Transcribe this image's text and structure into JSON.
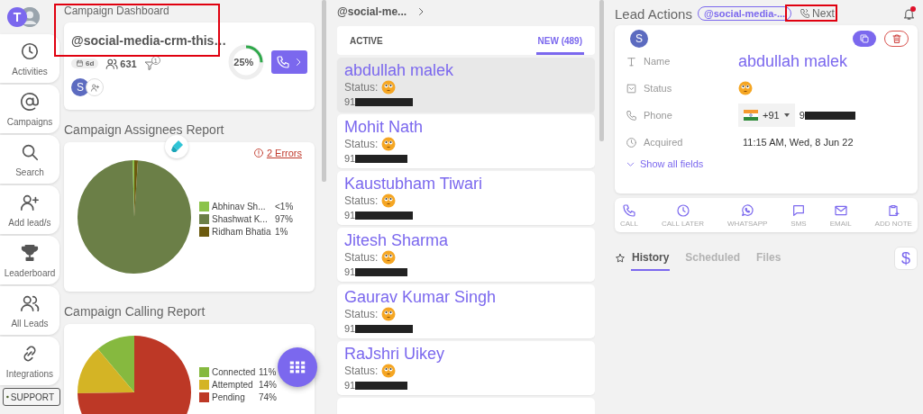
{
  "nav": {
    "avatar_letter": "T",
    "items": [
      {
        "label": "Activities",
        "selected": false
      },
      {
        "label": "Campaigns",
        "selected": false
      },
      {
        "label": "Search",
        "selected": false
      },
      {
        "label": "Add lead/s",
        "selected": false
      },
      {
        "label": "Leaderboard",
        "selected": false
      },
      {
        "label": "All Leads",
        "selected": false
      },
      {
        "label": "Integrations",
        "selected": false
      }
    ],
    "support": "SUPPORT"
  },
  "dashboard": {
    "title": "Campaign Dashboard",
    "campaign_name": "@social-media-crm-this…",
    "duration": "6d",
    "leads_count": "631",
    "filter_count": "1",
    "assignee_initial": "S",
    "progress": {
      "level": 0.25,
      "reading": "25%"
    }
  },
  "assignees_report": {
    "title": "Campaign Assignees Report",
    "errors_link": "2 Errors",
    "chart_data": {
      "type": "pie",
      "categories": [
        "Abhinav Sh...",
        "Shashwat K...",
        "Ridham Bhatia"
      ],
      "values": [
        0.5,
        97,
        1
      ],
      "value_labels": [
        "<1%",
        "97%",
        "1%"
      ]
    },
    "legend": [
      {
        "color": "#8bc34a"
      },
      {
        "color": "#6b7f47"
      },
      {
        "color": "#6b5a0e"
      }
    ]
  },
  "calling_report": {
    "title": "Campaign Calling Report",
    "chart_data": {
      "type": "pie",
      "categories": [
        "Connected",
        "Attempted",
        "Pending"
      ],
      "values": [
        11,
        14,
        74
      ],
      "value_labels": [
        "11%",
        "14%",
        "74%"
      ]
    },
    "legend": [
      {
        "color": "#86b93f"
      },
      {
        "color": "#d4b425"
      },
      {
        "color": "#bd3826"
      }
    ]
  },
  "lead_list": {
    "campaign": "@social-me...",
    "tabs": [
      {
        "label": "ACTIVE",
        "selected": false
      },
      {
        "label": "NEW (489)",
        "selected": true
      }
    ],
    "leads": [
      {
        "name": "abdullah malek",
        "status_label": "Status:",
        "phone_prefix": "91",
        "selected": true
      },
      {
        "name": "Mohit Nath",
        "status_label": "Status:",
        "phone_prefix": "91",
        "selected": false
      },
      {
        "name": "Kaustubham Tiwari",
        "status_label": "Status:",
        "phone_prefix": "91",
        "selected": false
      },
      {
        "name": "Jitesh Sharma",
        "status_label": "Status:",
        "phone_prefix": "91",
        "selected": false
      },
      {
        "name": "Gaurav Kumar Singh",
        "status_label": "Status:",
        "phone_prefix": "91",
        "selected": false
      },
      {
        "name": "RaJshri Uikey",
        "status_label": "Status:",
        "phone_prefix": "91",
        "selected": false
      }
    ]
  },
  "lead_actions": {
    "title": "Lead Actions",
    "campaign_chip": "@social-media-...",
    "next_label": "Next",
    "avatar_initial": "S",
    "fields": [
      {
        "kind": "name",
        "label": "Name",
        "value": "abdullah malek"
      },
      {
        "kind": "status",
        "label": "Status"
      },
      {
        "kind": "phone",
        "label": "Phone",
        "country_code": "+91",
        "value": "9"
      },
      {
        "kind": "date",
        "label": "Acquired",
        "value": "11:15 AM, Wed, 8 Jun 22"
      }
    ],
    "show_all": "Show all fields",
    "actions": [
      "CALL",
      "CALL LATER",
      "WHATSAPP",
      "SMS",
      "EMAIL",
      "ADD NOTE"
    ],
    "tabs": [
      {
        "label": "History",
        "selected": true
      },
      {
        "label": "Scheduled",
        "selected": false
      },
      {
        "label": "Files",
        "selected": false
      }
    ],
    "currency_button": "$"
  }
}
